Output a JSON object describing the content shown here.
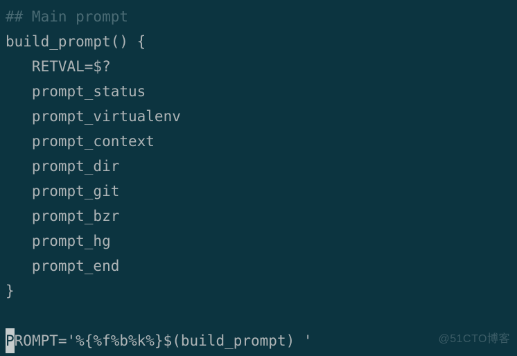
{
  "code": {
    "l1": "## Main prompt",
    "l2": "build_prompt() {",
    "l3": "   RETVAL=$?",
    "l4": "   prompt_status",
    "l5": "   prompt_virtualenv",
    "l6": "   prompt_context",
    "l7": "   prompt_dir",
    "l8": "   prompt_git",
    "l9": "   prompt_bzr",
    "l10": "   prompt_hg",
    "l11": "   prompt_end",
    "l12": "}",
    "l13": "",
    "l14_rest": "ROMPT='%{%f%b%k%}$(build_prompt) '"
  },
  "cursor_char": "P",
  "watermark": "@51CTO博客"
}
